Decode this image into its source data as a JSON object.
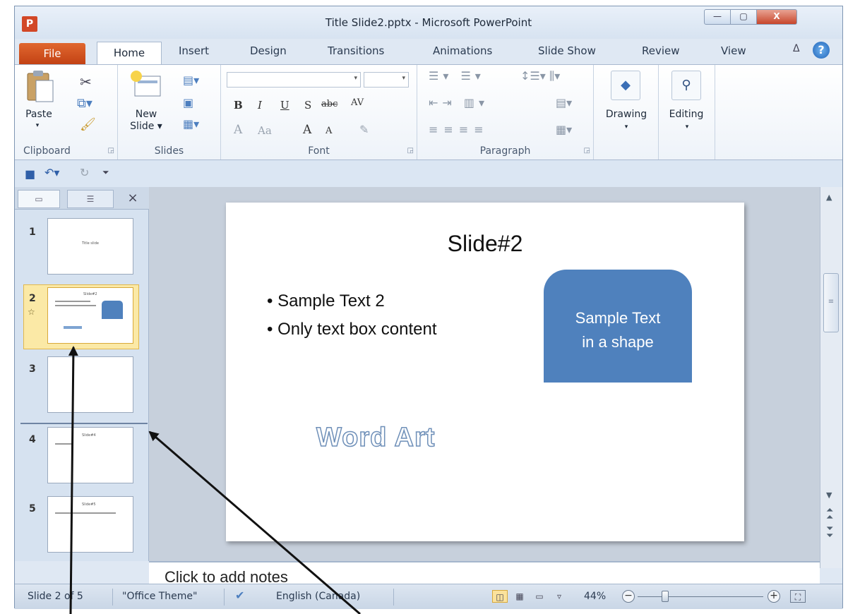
{
  "window": {
    "title": "Title Slide2.pptx - Microsoft PowerPoint",
    "app_icon": "P",
    "controls": {
      "minimize": "—",
      "maximize": "▢",
      "close": "X"
    }
  },
  "tabs": [
    "File",
    "Home",
    "Insert",
    "Design",
    "Transitions",
    "Animations",
    "Slide Show",
    "Review",
    "View"
  ],
  "ribbon": {
    "clipboard": {
      "paste": "Paste",
      "label": "Clipboard"
    },
    "slides": {
      "new_slide_line1": "New",
      "new_slide_line2": "Slide ▾",
      "label": "Slides"
    },
    "font": {
      "label": "Font",
      "bold": "B",
      "italic": "I",
      "underline": "U",
      "strike": "S",
      "abc": "abc",
      "av": "AV",
      "a_color": "A",
      "aa": "Aa",
      "grow": "A",
      "shrink": "A"
    },
    "paragraph": {
      "label": "Paragraph"
    },
    "drawing": {
      "label": "Drawing"
    },
    "editing": {
      "label": "Editing"
    }
  },
  "left_pane": {
    "close": "×",
    "thumbnails": [
      {
        "num": "1",
        "text": "Title slide"
      },
      {
        "num": "2",
        "text": "Slide#2"
      },
      {
        "num": "3",
        "text": ""
      },
      {
        "num": "4",
        "text": "Slide#4"
      },
      {
        "num": "5",
        "text": "Slide#5"
      }
    ],
    "selected": 2
  },
  "slide": {
    "title": "Slide#2",
    "bullets": [
      "Sample Text 2",
      "Only text box content"
    ],
    "shape_text_line1": "Sample Text",
    "shape_text_line2": "in a shape",
    "wordart": "Word Art"
  },
  "notes": {
    "placeholder": "Click to add notes"
  },
  "status_bar": {
    "slide_info": "Slide 2 of 5",
    "theme": "\"Office Theme\"",
    "language": "English (Canada)",
    "zoom": "44%",
    "zoom_level_fraction": 0.44
  },
  "colors": {
    "file_tab": "#c34214",
    "shape_fill": "#4f81bd",
    "selected_thumb": "#fbe9a6",
    "accent": "#2a3a50"
  }
}
